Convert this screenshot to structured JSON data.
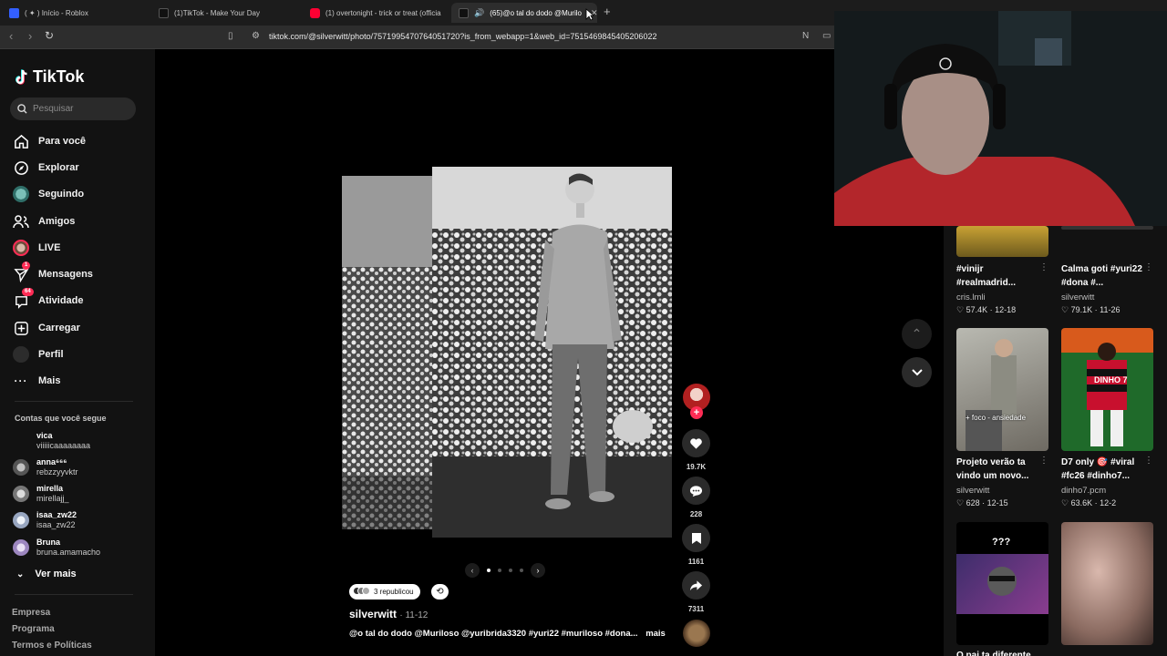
{
  "browser": {
    "tabs": [
      {
        "title": "( ✦ ) Início - Roblox",
        "active": false,
        "favicon_color": "#335fff"
      },
      {
        "title": "(1)TikTok - Make Your Day",
        "active": false,
        "favicon_color": "#000000"
      },
      {
        "title": "(1) overtonight - trick or treat (officia",
        "active": false,
        "favicon_color": "#ff0033"
      },
      {
        "title": "(65)@o tal do dodo @Murilo",
        "active": true,
        "favicon_color": "#000000"
      }
    ],
    "url": "tiktok.com/@silverwitt/photo/7571995470764051720?is_from_webapp=1&web_id=7515469845405206022"
  },
  "sidebar": {
    "brand": "TikTok",
    "search_placeholder": "Pesquisar",
    "nav": [
      {
        "label": "Para você",
        "icon": "home-icon",
        "active": true
      },
      {
        "label": "Explorar",
        "icon": "compass-icon"
      },
      {
        "label": "Seguindo",
        "icon": "following-avatar-icon"
      },
      {
        "label": "Amigos",
        "icon": "friends-icon"
      },
      {
        "label": "LIVE",
        "icon": "live-avatar-icon"
      },
      {
        "label": "Mensagens",
        "icon": "send-icon",
        "badge": "1"
      },
      {
        "label": "Atividade",
        "icon": "inbox-icon",
        "badge": "64"
      },
      {
        "label": "Carregar",
        "icon": "upload-icon"
      },
      {
        "label": "Perfil",
        "icon": "profile-avatar-icon"
      },
      {
        "label": "Mais",
        "icon": "more-icon"
      }
    ],
    "following_title": "Contas que você segue",
    "following": [
      {
        "name": "vica",
        "handle": "viiiiicaaaaaaaa",
        "color": "#121212"
      },
      {
        "name": "anna⁶⁶⁶",
        "handle": "rebzzyyvktr",
        "color": "#6a6a6a"
      },
      {
        "name": "mirella",
        "handle": "mirellajj_",
        "color": "#8a8a8a"
      },
      {
        "name": "isaa_zw22",
        "handle": "isaa_zw22",
        "color": "#b8c3d6"
      },
      {
        "name": "Bruna",
        "handle": "bruna.amamacho",
        "color": "#c4b5d8"
      }
    ],
    "see_more": "Ver mais",
    "footer": [
      "Empresa",
      "Programa",
      "Termos e Políticas"
    ]
  },
  "post": {
    "reposts": "3 republicou",
    "author": "silverwitt",
    "date": "· 11-12",
    "caption": "@o tal do dodo @Muriloso @yuribrida3320 #yuri22 #muriloso #dona...",
    "more": "mais",
    "slide_count": 4,
    "active_slide": 1,
    "likes": "19.7K",
    "comments": "228",
    "saves": "1161",
    "shares": "7311"
  },
  "related": [
    {
      "title": "#vinijr #realmadrid...",
      "author": "cris.lmli",
      "likes": "57.4K",
      "date": "12-18"
    },
    {
      "title": "Calma goti #yuri22 #dona #...",
      "author": "silverwitt",
      "likes": "79.1K",
      "date": "11-26"
    },
    {
      "title": "Projeto verão ta vindo um novo...",
      "author": "silverwitt",
      "likes": "628",
      "date": "12-15",
      "overlay": "+ foco - ansiedade"
    },
    {
      "title": "D7 only 🎯 #viral #fc26 #dinho7...",
      "author": "dinho7.pcm",
      "likes": "63.6K",
      "date": "12-2",
      "overlay": "DINHO 7"
    },
    {
      "title": "",
      "author": "",
      "likes": "",
      "date": "",
      "overlay": "???"
    },
    {
      "title": "O pai ta diferente",
      "author": "",
      "likes": "",
      "date": ""
    }
  ]
}
